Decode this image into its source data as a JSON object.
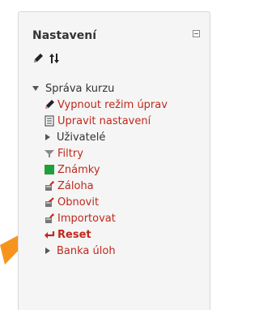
{
  "block": {
    "title": "Nastavení",
    "collapse_icon": "collapse-icon",
    "move_icons": [
      "edit-pencil-icon",
      "move-arrows-icon"
    ]
  },
  "tree": {
    "root": {
      "label": "Správa kurzu",
      "icon": "expanded-triangle-icon"
    },
    "items": [
      {
        "label": "Vypnout režim úprav",
        "icon": "pencil-icon"
      },
      {
        "label": "Upravit nastavení",
        "icon": "document-icon"
      },
      {
        "label": "Uživatelé",
        "icon": "collapsed-triangle-icon"
      },
      {
        "label": "Filtry",
        "icon": "funnel-icon"
      },
      {
        "label": "Známky",
        "icon": "grades-table-icon"
      },
      {
        "label": "Záloha",
        "icon": "backup-icon"
      },
      {
        "label": "Obnovit",
        "icon": "restore-icon"
      },
      {
        "label": "Importovat",
        "icon": "import-icon"
      },
      {
        "label": "Reset",
        "icon": "reset-arrow-icon"
      },
      {
        "label": "Banka úloh",
        "icon": "collapsed-triangle-icon"
      }
    ]
  },
  "colors": {
    "link": "#c0281c",
    "text": "#333333",
    "panel_bg": "#f5f5f5",
    "panel_border": "#d7d7d7",
    "callout": "#f7941d"
  }
}
